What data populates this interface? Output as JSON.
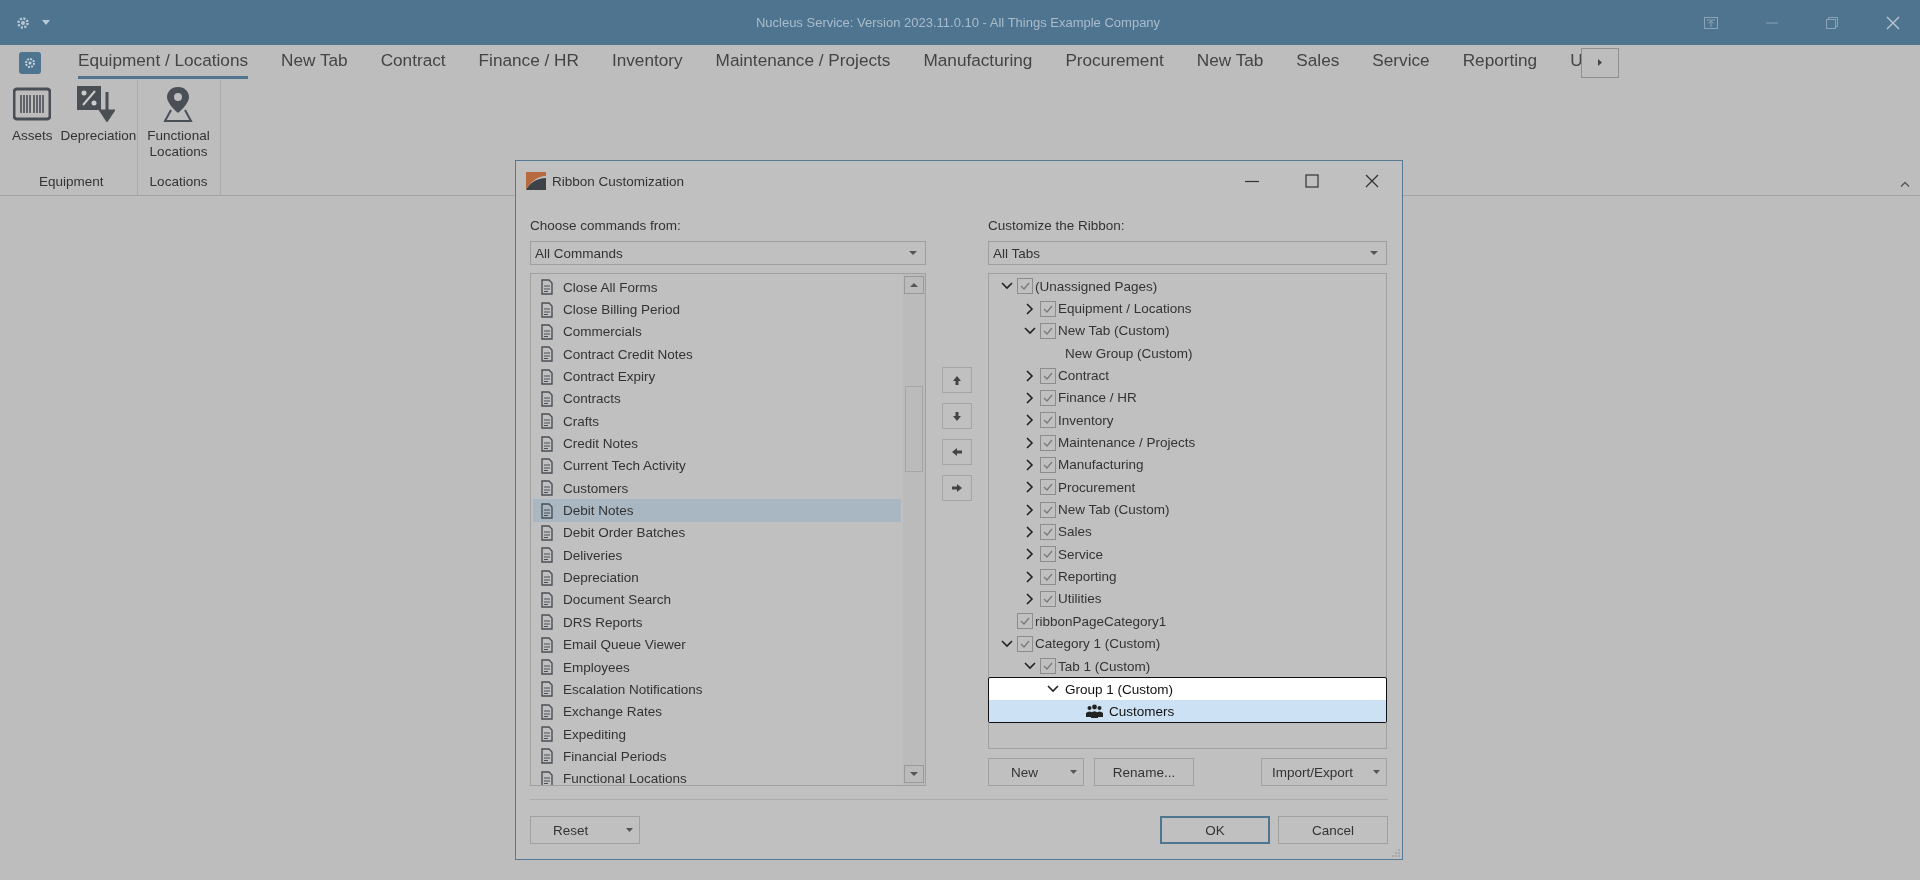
{
  "window": {
    "title": "Nucleus Service: Version 2023.11.0.10 - All Things Example Company"
  },
  "ribbon": {
    "tabs": [
      {
        "label": "Equipment / Locations",
        "selected": true
      },
      {
        "label": "New Tab",
        "selected": false
      },
      {
        "label": "Contract",
        "selected": false
      },
      {
        "label": "Finance / HR",
        "selected": false
      },
      {
        "label": "Inventory",
        "selected": false
      },
      {
        "label": "Maintenance / Projects",
        "selected": false
      },
      {
        "label": "Manufacturing",
        "selected": false
      },
      {
        "label": "Procurement",
        "selected": false
      },
      {
        "label": "New Tab",
        "selected": false
      },
      {
        "label": "Sales",
        "selected": false
      },
      {
        "label": "Service",
        "selected": false
      },
      {
        "label": "Reporting",
        "selected": false
      },
      {
        "label": "U",
        "selected": false
      }
    ],
    "groups": [
      {
        "label": "Equipment",
        "commands": [
          "Assets",
          "Depreciation"
        ]
      },
      {
        "label": "Locations",
        "commands": [
          "Functional Locations"
        ]
      }
    ]
  },
  "dialog": {
    "title": "Ribbon Customization",
    "left": {
      "label": "Choose commands from:",
      "combo": "All Commands",
      "items": [
        {
          "label": "Close All Forms",
          "selected": false
        },
        {
          "label": "Close Billing Period",
          "selected": false
        },
        {
          "label": "Commercials",
          "selected": false
        },
        {
          "label": "Contract Credit Notes",
          "selected": false
        },
        {
          "label": "Contract Expiry",
          "selected": false
        },
        {
          "label": "Contracts",
          "selected": false
        },
        {
          "label": "Crafts",
          "selected": false
        },
        {
          "label": "Credit Notes",
          "selected": false
        },
        {
          "label": "Current Tech Activity",
          "selected": false
        },
        {
          "label": "Customers",
          "selected": false
        },
        {
          "label": "Debit Notes",
          "selected": true
        },
        {
          "label": "Debit Order Batches",
          "selected": false
        },
        {
          "label": "Deliveries",
          "selected": false
        },
        {
          "label": "Depreciation",
          "selected": false
        },
        {
          "label": "Document Search",
          "selected": false
        },
        {
          "label": "DRS Reports",
          "selected": false
        },
        {
          "label": "Email Queue Viewer",
          "selected": false
        },
        {
          "label": "Employees",
          "selected": false
        },
        {
          "label": "Escalation Notifications",
          "selected": false
        },
        {
          "label": "Exchange Rates",
          "selected": false
        },
        {
          "label": "Expediting",
          "selected": false
        },
        {
          "label": "Financial Periods",
          "selected": false
        },
        {
          "label": "Functional Locations",
          "selected": false
        }
      ]
    },
    "right": {
      "label": "Customize the Ribbon:",
      "combo": "All Tabs",
      "tree": [
        {
          "kind": "page",
          "label": "(Unassigned Pages)",
          "checked": true,
          "expanded": true,
          "selected": false,
          "children": [
            {
              "kind": "page",
              "label": "Equipment / Locations",
              "checked": true,
              "expanded": false,
              "selected": false
            },
            {
              "kind": "page",
              "label": "New Tab (Custom)",
              "checked": true,
              "expanded": true,
              "selected": false,
              "children": [
                {
                  "kind": "group",
                  "label": "New Group (Custom)",
                  "selected": false
                }
              ]
            },
            {
              "kind": "page",
              "label": "Contract",
              "checked": true,
              "expanded": false,
              "selected": false
            },
            {
              "kind": "page",
              "label": "Finance / HR",
              "checked": true,
              "expanded": false,
              "selected": false
            },
            {
              "kind": "page",
              "label": "Inventory",
              "checked": true,
              "expanded": false,
              "selected": false
            },
            {
              "kind": "page",
              "label": "Maintenance / Projects",
              "checked": true,
              "expanded": false,
              "selected": false
            },
            {
              "kind": "page",
              "label": "Manufacturing",
              "checked": true,
              "expanded": false,
              "selected": false
            },
            {
              "kind": "page",
              "label": "Procurement",
              "checked": true,
              "expanded": false,
              "selected": false
            },
            {
              "kind": "page",
              "label": "New Tab (Custom)",
              "checked": true,
              "expanded": false,
              "selected": false
            },
            {
              "kind": "page",
              "label": "Sales",
              "checked": true,
              "expanded": false,
              "selected": false
            },
            {
              "kind": "page",
              "label": "Service",
              "checked": true,
              "expanded": false,
              "selected": false
            },
            {
              "kind": "page",
              "label": "Reporting",
              "checked": true,
              "expanded": false,
              "selected": false
            },
            {
              "kind": "page",
              "label": "Utilities",
              "checked": true,
              "expanded": false,
              "selected": false
            }
          ]
        },
        {
          "kind": "page",
          "label": "ribbonPageCategory1",
          "checked": true,
          "selected": false
        },
        {
          "kind": "page",
          "label": "Category 1 (Custom)",
          "checked": true,
          "expanded": true,
          "selected": false,
          "children": [
            {
              "kind": "page",
              "label": "Tab 1 (Custom)",
              "checked": true,
              "expanded": true,
              "selected": false,
              "children": [
                {
                  "kind": "group",
                  "label": "Group 1 (Custom)",
                  "expanded": true,
                  "focused": true,
                  "selected": false,
                  "children": [
                    {
                      "kind": "command",
                      "label": "Customers",
                      "selected": true
                    }
                  ]
                }
              ]
            }
          ]
        }
      ],
      "buttons": [
        "New",
        "Rename...",
        "Import/Export"
      ]
    },
    "footer": {
      "reset": "Reset",
      "ok": "OK",
      "cancel": "Cancel"
    }
  }
}
